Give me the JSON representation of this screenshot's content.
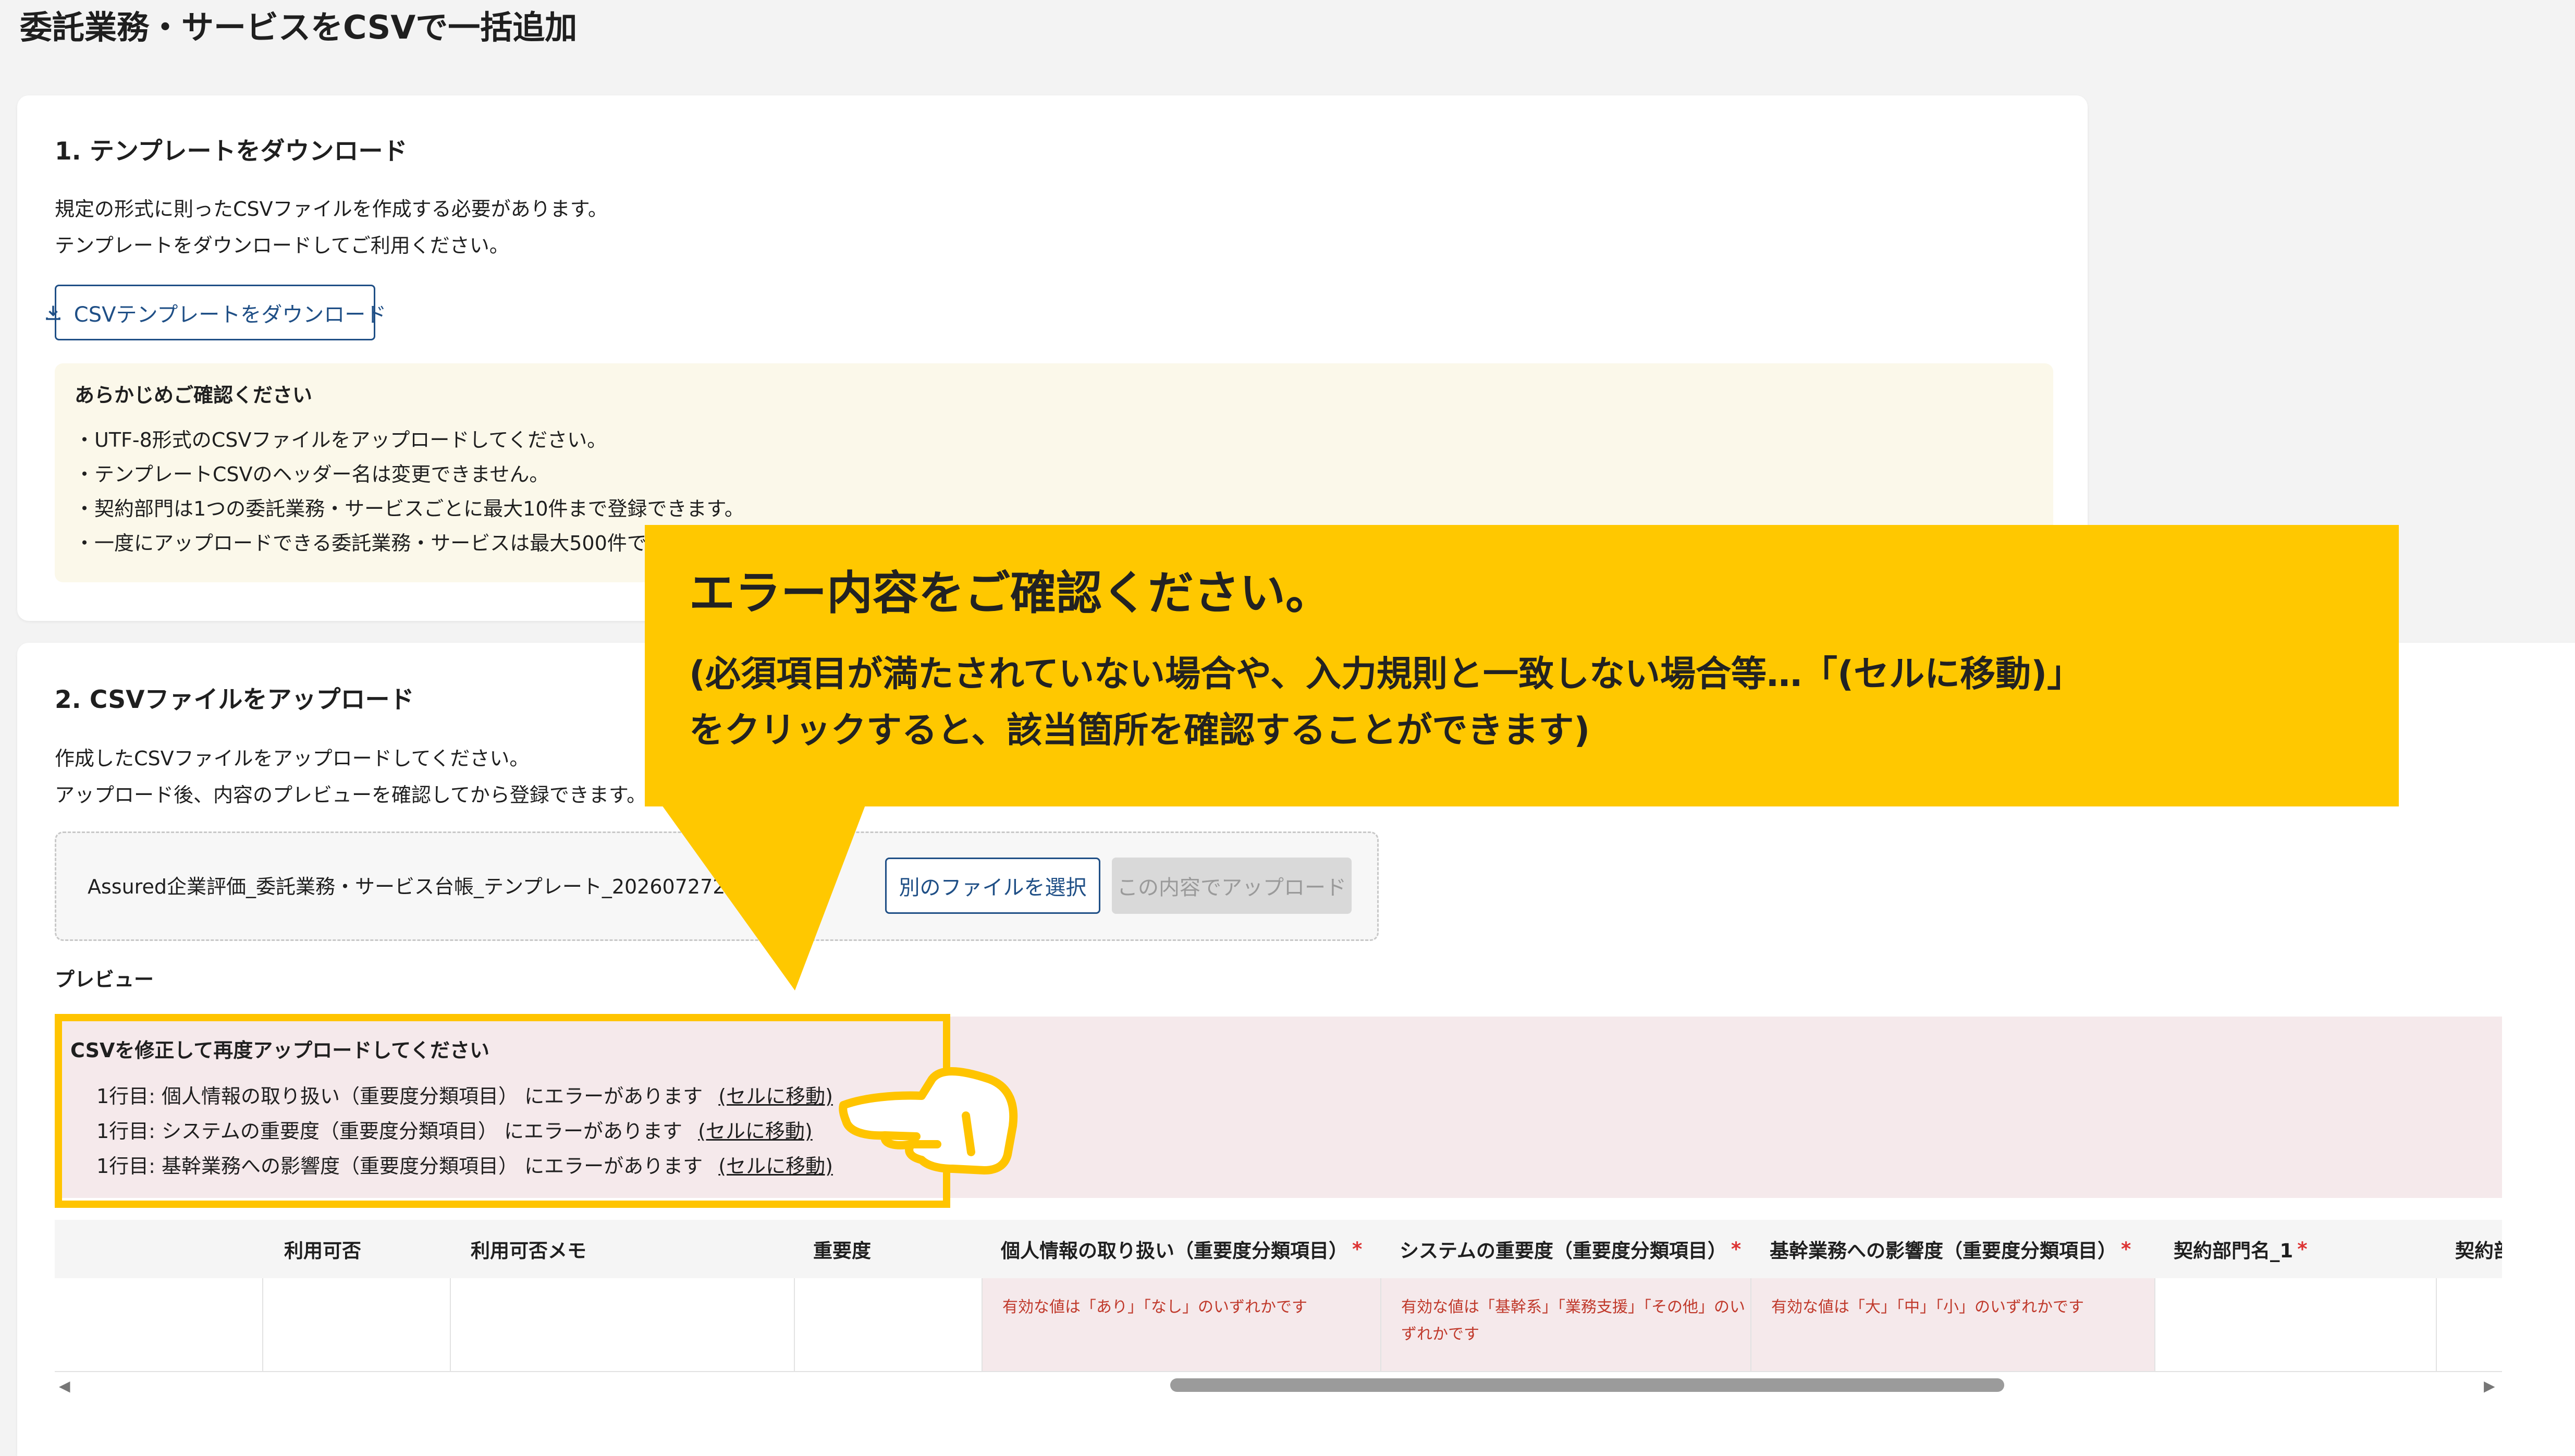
{
  "page": {
    "title": "委託業務・サービスをCSVで一括追加"
  },
  "step1": {
    "title": "1. テンプレートをダウンロード",
    "desc_line1": "規定の形式に則ったCSVファイルを作成する必要があります。",
    "desc_line2": "テンプレートをダウンロードしてご利用ください。",
    "download_button": "CSVテンプレートをダウンロード",
    "download_icon": "download-icon",
    "notice": {
      "title": "あらかじめご確認ください",
      "items": [
        "・UTF-8形式のCSVファイルをアップロードしてください。",
        "・テンプレートCSVのヘッダー名は変更できません。",
        "・契約部門は1つの委託業務・サービスごとに最大10件まで登録できます。",
        "・一度にアップロードできる委託業務・サービスは最大500件です。"
      ]
    }
  },
  "step2": {
    "title": "2. CSVファイルをアップロード",
    "desc_line1": "作成したCSVファイルをアップロードしてください。",
    "desc_line2": "アップロード後、内容のプレビューを確認してから登録できます。",
    "file_name": "Assured企業評価_委託業務・サービス台帳_テンプレート_202607272224.csv",
    "select_other_button": "別のファイルを選択",
    "upload_button": "この内容でアップロード",
    "preview_label": "プレビュー"
  },
  "errors": {
    "title": "CSVを修正して再度アップロードしてください",
    "link_label": "(セルに移動)",
    "lines": [
      "1行目: 個人情報の取り扱い（重要度分類項目） にエラーがあります",
      "1行目: システムの重要度（重要度分類項目） にエラーがあります",
      "1行目: 基幹業務への影響度（重要度分類項目） にエラーがあります"
    ]
  },
  "table": {
    "columns": [
      {
        "label": "利用可否",
        "required": false
      },
      {
        "label": "利用可否メモ",
        "required": false
      },
      {
        "label": "重要度",
        "required": false
      },
      {
        "label": "個人情報の取り扱い（重要度分類項目）",
        "required": true
      },
      {
        "label": "システムの重要度（重要度分類項目）",
        "required": true
      },
      {
        "label": "基幹業務への影響度（重要度分類項目）",
        "required": true
      },
      {
        "label": "契約部門名_1",
        "required": true
      },
      {
        "label": "契約部",
        "required": false
      }
    ],
    "required_mark": "*",
    "cell_errors": {
      "personal_info_1": "有効な値は「あり」「なし」のいずれかです",
      "system_1": "有効な値は「基幹系」「業務支援」「その他」のい",
      "system_2": "ずれかです",
      "business_1": "有効な値は「大」「中」「小」のいずれかです"
    }
  },
  "callout": {
    "headline": "エラー内容をご確認ください。",
    "sub_line1": "(必須項目が満たされていない場合や、入力規則と一致しない場合等…「(セルに移動)」",
    "sub_line2": "をクリックすると、該当箇所を確認することができます)",
    "color": "#ffc800"
  },
  "colors": {
    "accent": "#1f4f86",
    "error_bg": "#f5e9eb",
    "highlight": "#ffc400"
  }
}
